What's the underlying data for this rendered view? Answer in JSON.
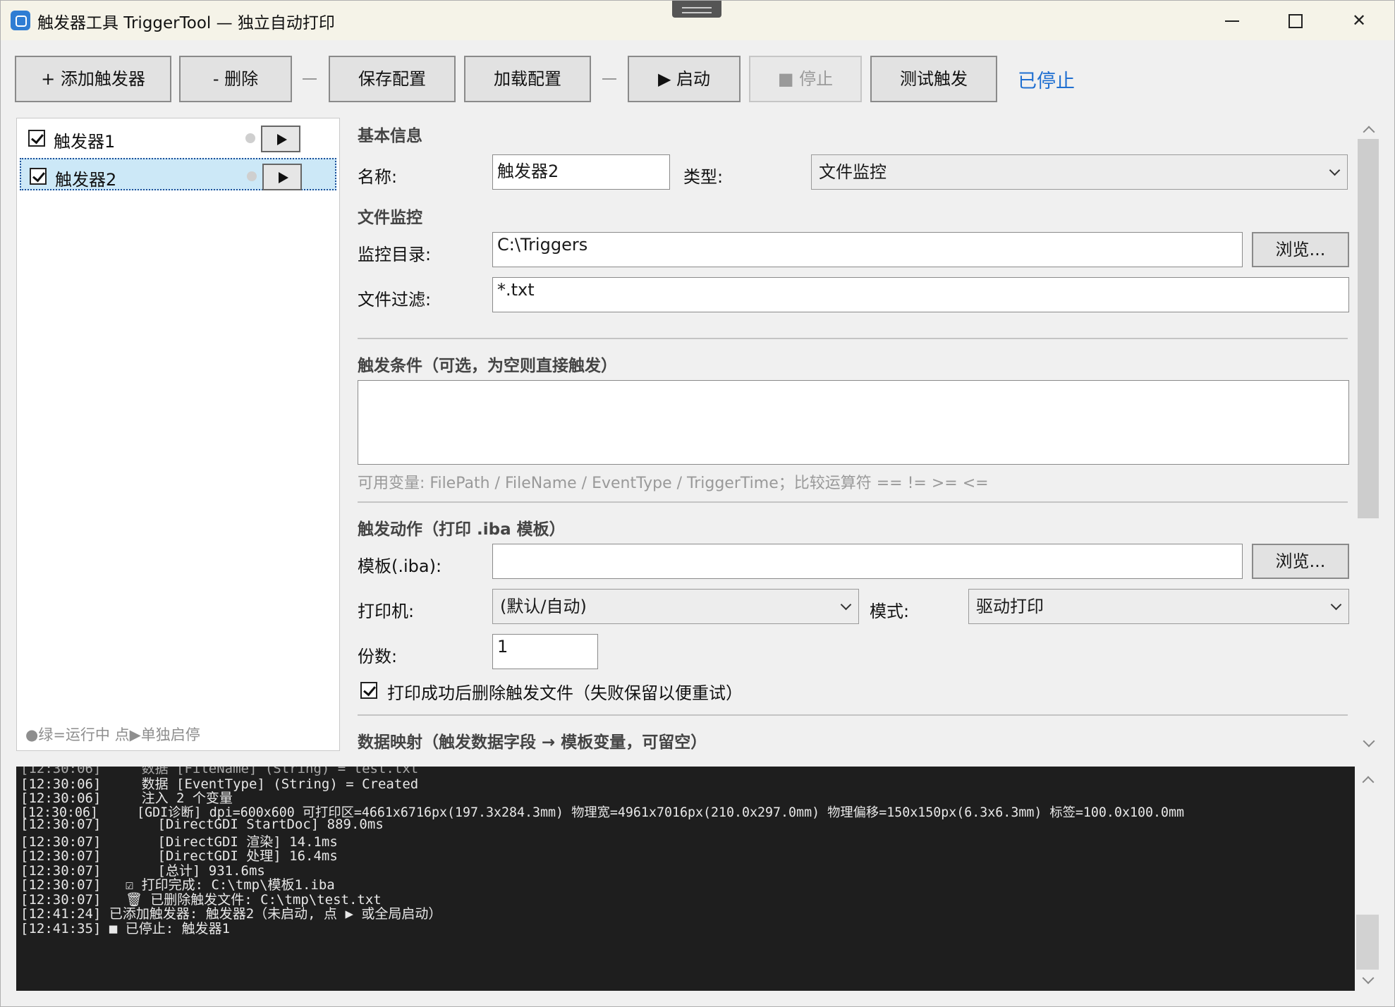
{
  "window": {
    "title": "触发器工具 TriggerTool — 独立自动打印"
  },
  "toolbar": {
    "add_label": "+ 添加触发器",
    "delete_label": "-  删除",
    "save_label": "保存配置",
    "load_label": "加载配置",
    "start_label": "▶ 启动",
    "stop_label": "■ 停止",
    "test_label": "测试触发",
    "status": "已停止"
  },
  "trigger_list": {
    "items": [
      {
        "label": "触发器1",
        "checked": true,
        "selected": false
      },
      {
        "label": "触发器2",
        "checked": true,
        "selected": true
      }
    ],
    "hint": "●绿=运行中 点▶单独启停"
  },
  "form": {
    "basic_section": "基本信息",
    "name_label": "名称:",
    "name_value": "触发器2",
    "type_label": "类型:",
    "type_value": "文件监控",
    "file_section": "文件监控",
    "dir_label": "监控目录:",
    "dir_value": "C:\\Triggers",
    "browse_label": "浏览...",
    "filter_label": "文件过滤:",
    "filter_value": "*.txt",
    "condition_section": "触发条件（可选，为空则直接触发）",
    "condition_value": "",
    "condition_hint": "可用变量: FilePath / FileName / EventType / TriggerTime；比较运算符 == != >= <=",
    "action_section": "触发动作（打印 .iba 模板）",
    "template_label": "模板(.iba):",
    "template_value": "",
    "printer_label": "打印机:",
    "printer_value": "(默认/自动)",
    "mode_label": "模式:",
    "mode_value": "驱动打印",
    "copies_label": "份数:",
    "copies_value": "1",
    "delete_after_label": "打印成功后删除触发文件（失败保留以便重试）",
    "delete_after_checked": true,
    "mapping_section": "数据映射（触发数据字段 → 模板变量，可留空）"
  },
  "log": {
    "lines": [
      "[12:30:06]     数据 [EventType] (String) = Created",
      "[12:30:06]     注入 2 个变量",
      "[12:30:06]     [GDI诊断] dpi=600x600 可打印区=4661x6716px(197.3x284.3mm) 物理宽=4961x7016px(210.0x297.0mm) 物理偏移=150x150px(6.3x6.3mm) 标签=100.0x100.0mm",
      "[12:30:07]       [DirectGDI StartDoc] 889.0ms",
      "[12:30:07]       [DirectGDI 渲染] 14.1ms",
      "[12:30:07]       [DirectGDI 处理] 16.4ms",
      "[12:30:07]       [总计] 931.6ms",
      "[12:30:07]   ☑ 打印完成: C:\\tmp\\模板1.iba",
      "[12:30:07]   🗑 已删除触发文件: C:\\tmp\\test.txt",
      "[12:41:24] 已添加触发器: 触发器2（未启动, 点 ▶ 或全局启动）",
      "[12:41:35] ■ 已停止: 触发器1"
    ]
  }
}
